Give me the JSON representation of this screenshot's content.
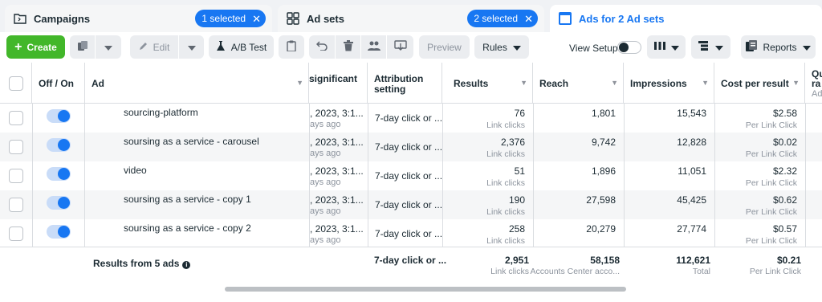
{
  "nav": {
    "campaigns": {
      "label": "Campaigns",
      "badge": "1 selected"
    },
    "adsets": {
      "label": "Ad sets",
      "badge": "2 selected"
    },
    "ads": {
      "label": "Ads for 2 Ad sets"
    }
  },
  "toolbar": {
    "create_label": "Create",
    "edit_label": "Edit",
    "ab_label": "A/B Test",
    "preview_label": "Preview",
    "rules_label": "Rules",
    "view_setup_label": "View Setup",
    "reports_label": "Reports"
  },
  "table": {
    "headers": {
      "off_on": "Off / On",
      "ad": "Ad",
      "significant": "significant",
      "attribution": "Attribution setting",
      "results": "Results",
      "reach": "Reach",
      "impressions": "Impressions",
      "cost": "Cost per result",
      "qual_a": "Qu",
      "qual_b": "ra",
      "qual_c": "Ad"
    },
    "rows": [
      {
        "name": "sourcing-platform",
        "sig_top": ", 2023, 3:1...",
        "sig_bot": "ays ago",
        "attribution": "7-day click or ...",
        "results": "76",
        "results_sub": "Link clicks",
        "reach": "1,801",
        "impressions": "15,543",
        "cost": "$2.58",
        "cost_sub": "Per Link Click"
      },
      {
        "name": "soursing as a service - carousel",
        "sig_top": ", 2023, 3:1...",
        "sig_bot": "ays ago",
        "attribution": "7-day click or ...",
        "results": "2,376",
        "results_sub": "Link clicks",
        "reach": "9,742",
        "impressions": "12,828",
        "cost": "$0.02",
        "cost_sub": "Per Link Click"
      },
      {
        "name": "video",
        "sig_top": ", 2023, 3:1...",
        "sig_bot": "ays ago",
        "attribution": "7-day click or ...",
        "results": "51",
        "results_sub": "Link clicks",
        "reach": "1,896",
        "impressions": "11,051",
        "cost": "$2.32",
        "cost_sub": "Per Link Click"
      },
      {
        "name": "soursing as a service - copy 1",
        "sig_top": ", 2023, 3:1...",
        "sig_bot": "ays ago",
        "attribution": "7-day click or ...",
        "results": "190",
        "results_sub": "Link clicks",
        "reach": "27,598",
        "impressions": "45,425",
        "cost": "$0.62",
        "cost_sub": "Per Link Click"
      },
      {
        "name": "soursing as a service - copy 2",
        "sig_top": ", 2023, 3:1...",
        "sig_bot": "ays ago",
        "attribution": "7-day click or ...",
        "results": "258",
        "results_sub": "Link clicks",
        "reach": "20,279",
        "impressions": "27,774",
        "cost": "$0.57",
        "cost_sub": "Per Link Click"
      }
    ],
    "footer": {
      "label": "Results from 5 ads",
      "attribution": "7-day click or ...",
      "results": "2,951",
      "results_sub": "Link clicks",
      "reach": "58,158",
      "reach_sub": "Accounts Center acco...",
      "impressions": "112,621",
      "impressions_sub": "Total",
      "cost": "$0.21",
      "cost_sub": "Per Link Click"
    }
  },
  "colors": {
    "accent": "#1877f2",
    "create": "#42b72a",
    "border": "#dadde1",
    "muted": "#8d949e"
  }
}
